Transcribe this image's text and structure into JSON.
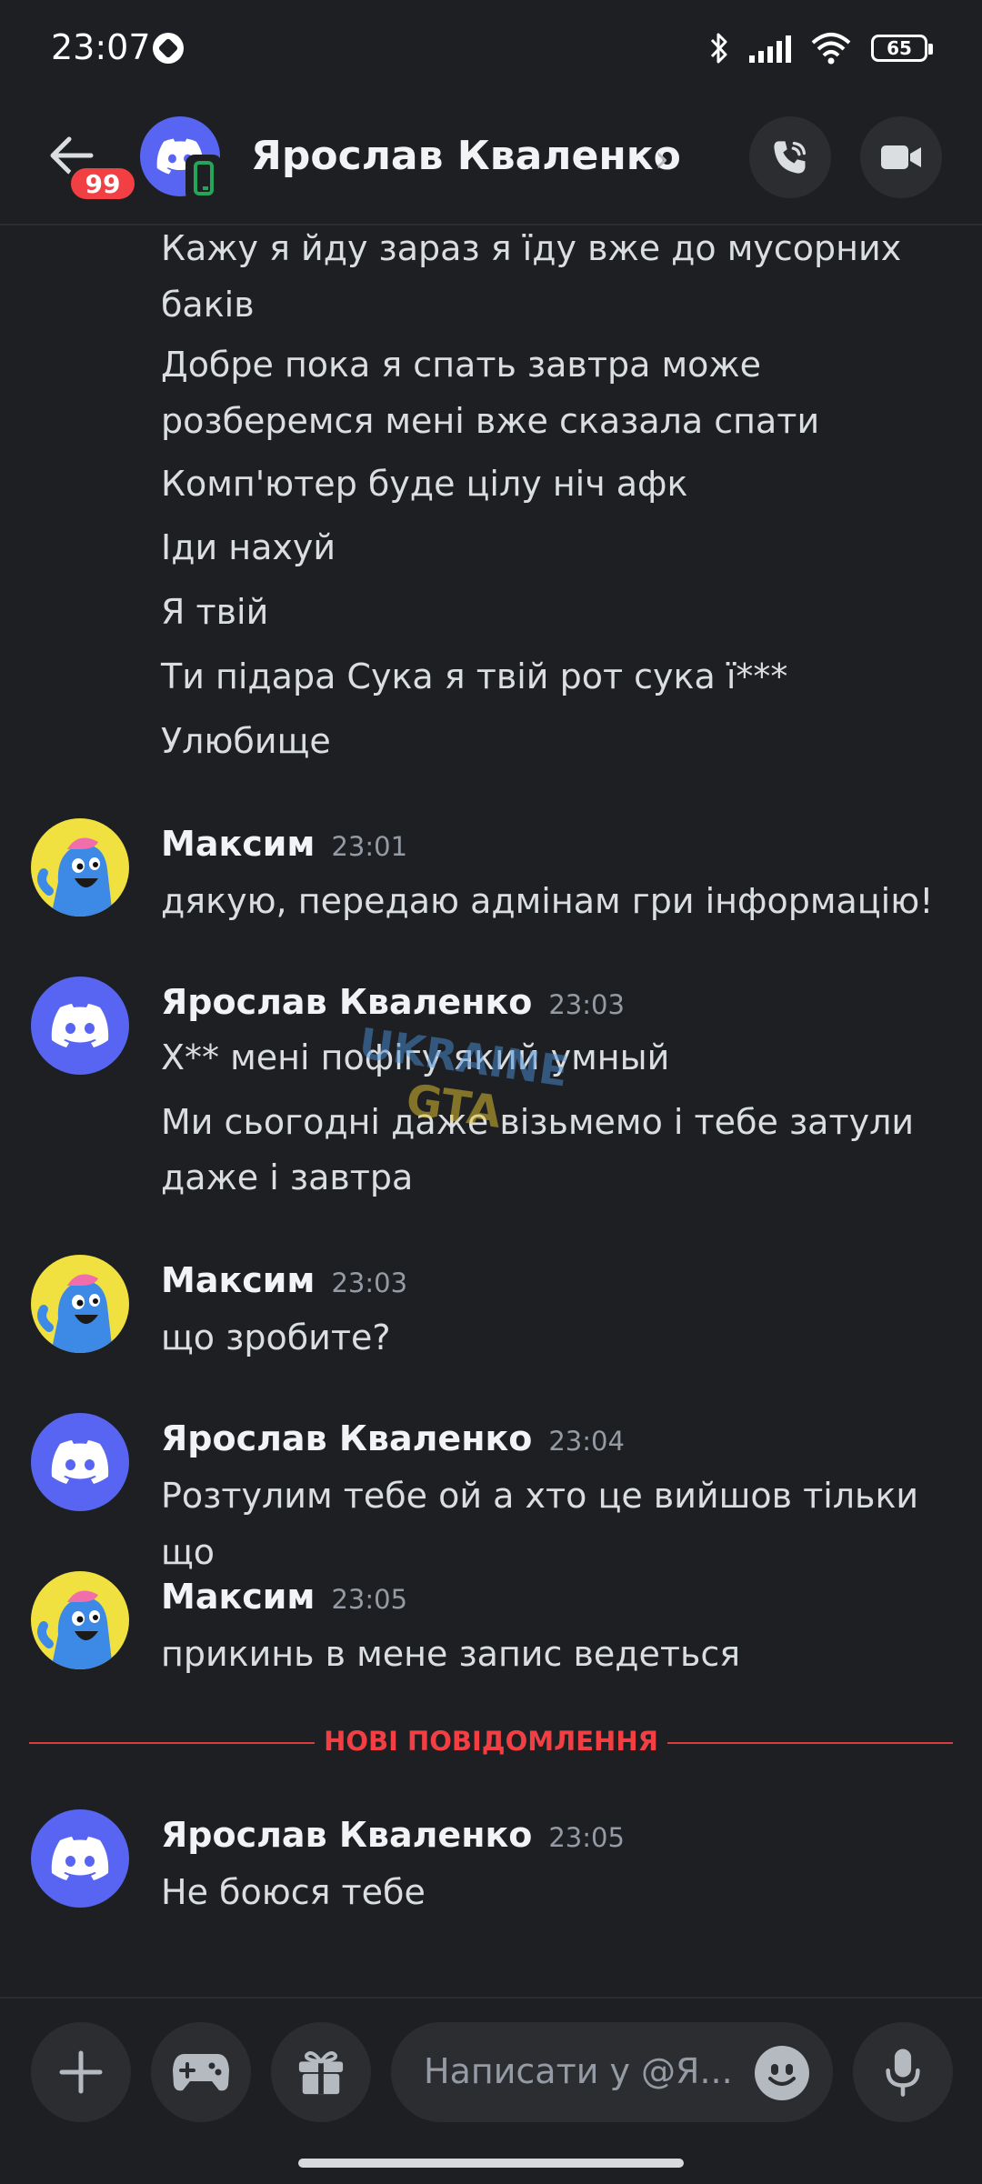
{
  "status_bar": {
    "time": "23:07",
    "battery": "65"
  },
  "header": {
    "badge": "99",
    "title": "Ярослав Кваленко",
    "chevron": "›"
  },
  "continuation": [
    "Кажу я йду зараз я їду вже до мусорних",
    "баків",
    "Добре пока я спать завтра може",
    "розберемся мені вже сказала спати",
    "Комп'ютер буде цілу ніч афк",
    "Іди нахуй",
    "Я твій",
    "Ти підара Сука я твій рот сука ї***",
    "Улюбище"
  ],
  "messages": [
    {
      "author": "Максим",
      "time": "23:01",
      "lines": [
        "дякую, передаю адмінам гри інформацію!"
      ]
    },
    {
      "author": "Ярослав Кваленко",
      "time": "23:03",
      "lines": [
        "Х** мені пофігу який умный",
        "Ми сьогодні даже візьмемо і тебе затули",
        "даже і завтра"
      ]
    },
    {
      "author": "Максим",
      "time": "23:03",
      "lines": [
        "що зробите?"
      ]
    },
    {
      "author": "Ярослав Кваленко",
      "time": "23:04",
      "lines": [
        "Розтулим тебе ой а хто це вийшов тільки що"
      ]
    },
    {
      "author": "Максим",
      "time": "23:05",
      "lines": [
        "прикинь в мене запис ведеться"
      ]
    },
    {
      "author": "Ярослав Кваленко",
      "time": "23:05",
      "lines": [
        "Не боюся тебе"
      ]
    }
  ],
  "new_messages_divider": "НОВІ ПОВІДОМЛЕННЯ",
  "composer": {
    "placeholder": "Написати у @Я..."
  },
  "watermark": {
    "line1": "UKRAINE",
    "line2": "GTA"
  },
  "colors": {
    "accent": "#5865f2",
    "danger": "#f23f43",
    "online": "#23a55a",
    "background": "#1e1f22"
  }
}
